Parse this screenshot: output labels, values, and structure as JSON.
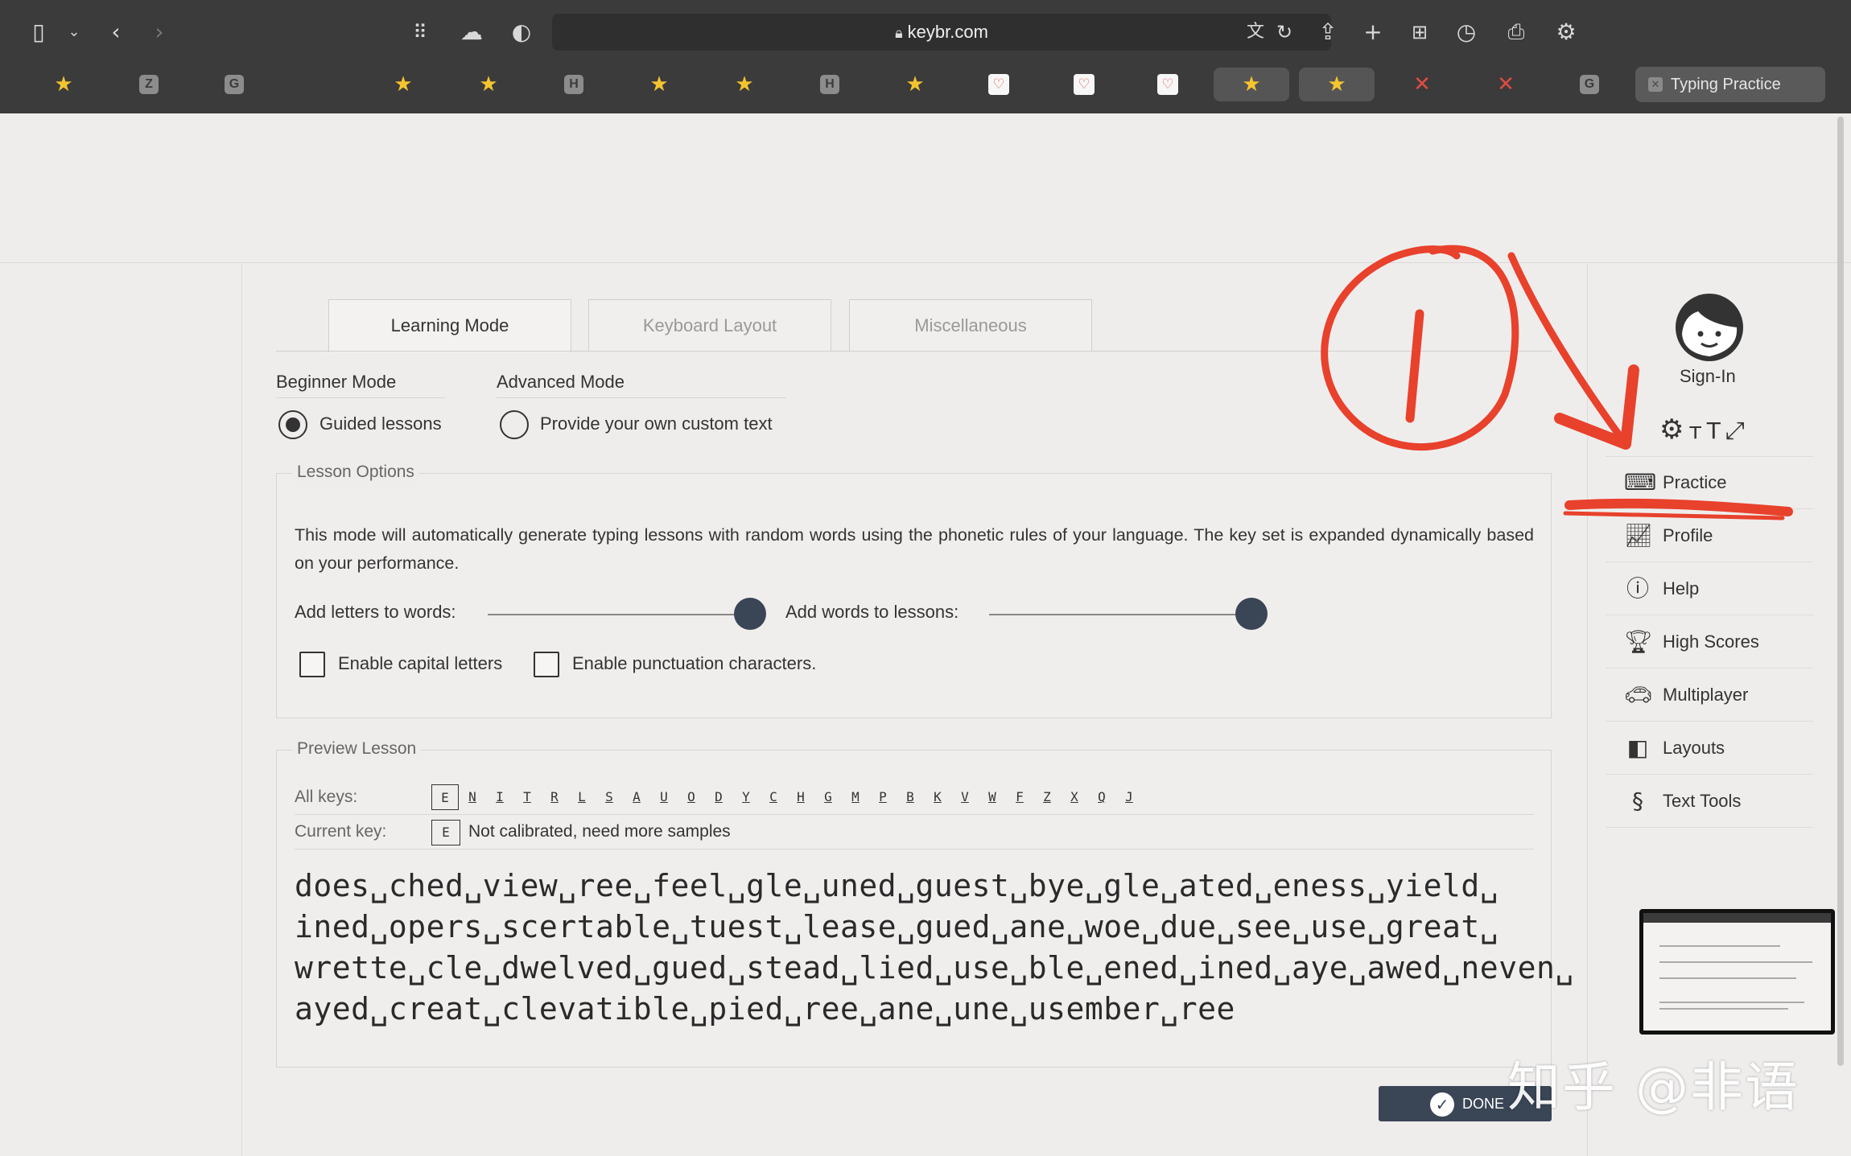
{
  "browser": {
    "url": "keybr.com",
    "active_tab": "Typing Practice",
    "favorites": [
      {
        "kind": "star"
      },
      {
        "kind": "letter",
        "text": "Z"
      },
      {
        "kind": "letter",
        "text": "G"
      },
      {
        "kind": "star"
      },
      {
        "kind": "star"
      },
      {
        "kind": "letter",
        "text": "H"
      },
      {
        "kind": "star"
      },
      {
        "kind": "star"
      },
      {
        "kind": "letter",
        "text": "H"
      },
      {
        "kind": "star"
      },
      {
        "kind": "heart"
      },
      {
        "kind": "heart"
      },
      {
        "kind": "heart"
      },
      {
        "kind": "star",
        "active": true
      },
      {
        "kind": "star",
        "active": true
      },
      {
        "kind": "kite"
      },
      {
        "kind": "kite"
      },
      {
        "kind": "letter",
        "text": "G"
      }
    ]
  },
  "tabs": [
    "Learning Mode",
    "Keyboard Layout",
    "Miscellaneous"
  ],
  "modes": {
    "beginner_label": "Beginner Mode",
    "beginner_option": "Guided lessons",
    "advanced_label": "Advanced Mode",
    "advanced_option": "Provide your own custom text"
  },
  "lesson_options": {
    "legend": "Lesson Options",
    "description": "This mode will automatically generate typing lessons with random words using the phonetic rules of your language. The key set is expanded dynamically based on your performance.",
    "add_letters_label": "Add letters to words:",
    "add_letters_value": 1.0,
    "add_words_label": "Add words to lessons:",
    "add_words_value": 1.0,
    "capital_label": "Enable capital letters",
    "punctuation_label": "Enable punctuation characters."
  },
  "preview": {
    "legend": "Preview Lesson",
    "all_keys_label": "All keys:",
    "keys": [
      "E",
      "N",
      "I",
      "T",
      "R",
      "L",
      "S",
      "A",
      "U",
      "O",
      "D",
      "Y",
      "C",
      "H",
      "G",
      "M",
      "P",
      "B",
      "K",
      "V",
      "W",
      "F",
      "Z",
      "X",
      "Q",
      "J"
    ],
    "current_key_label": "Current key:",
    "current_key": "E",
    "current_key_status": "Not calibrated, need more samples",
    "lesson_lines": [
      "does␣ched␣view␣ree␣feel␣gle␣uned␣guest␣bye␣gle␣ated␣eness␣yield␣",
      "ined␣opers␣scertable␣tuest␣lease␣gued␣ane␣woe␣due␣see␣use␣great␣",
      "wrette␣cle␣dwelved␣gued␣stead␣lied␣use␣ble␣ened␣ined␣aye␣awed␣neven␣",
      "ayed␣creat␣clevatible␣pied␣ree␣ane␣une␣usember␣ree"
    ]
  },
  "done_label": "DONE",
  "sidebar": {
    "signin": "Sign-In",
    "items": [
      {
        "label": "Practice",
        "icon": "keyboard-icon"
      },
      {
        "label": "Profile",
        "icon": "chart-icon"
      },
      {
        "label": "Help",
        "icon": "help-icon"
      },
      {
        "label": "High Scores",
        "icon": "trophy-icon"
      },
      {
        "label": "Multiplayer",
        "icon": "car-icon"
      },
      {
        "label": "Layouts",
        "icon": "layouts-icon"
      },
      {
        "label": "Text Tools",
        "icon": "section-icon"
      }
    ]
  },
  "watermark": "知乎 @非语",
  "colors": {
    "accent": "#3a4556",
    "annotation": "#e8412c",
    "chrome": "#3b3b3b"
  }
}
